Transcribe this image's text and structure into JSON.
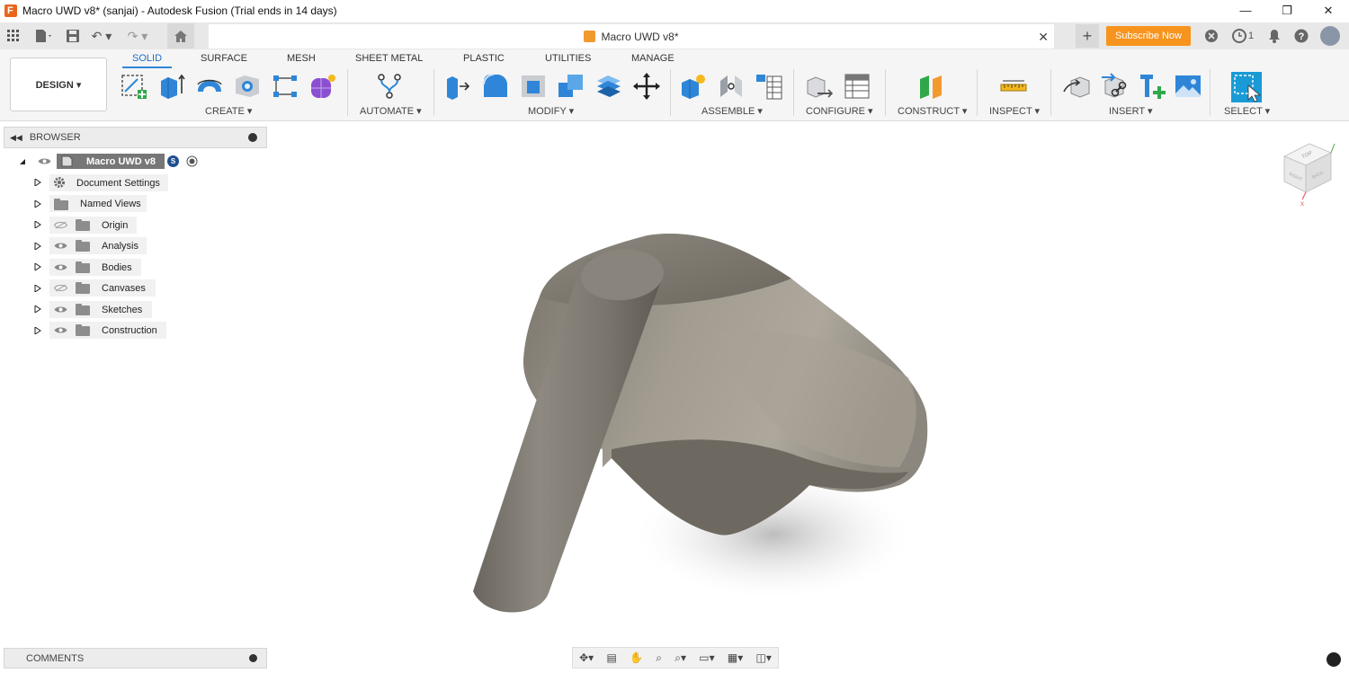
{
  "window": {
    "title": "Macro UWD v8* (sanjai) - Autodesk Fusion (Trial ends in 14 days)"
  },
  "document_tab": {
    "name": "Macro UWD v8*"
  },
  "header_right": {
    "subscribe_label": "Subscribe Now",
    "job_count": "1"
  },
  "workspace": {
    "label": "DESIGN ▾"
  },
  "ribbon_tabs": [
    "SOLID",
    "SURFACE",
    "MESH",
    "SHEET METAL",
    "PLASTIC",
    "UTILITIES",
    "MANAGE"
  ],
  "ribbon_groups": {
    "create": "CREATE ▾",
    "automate": "AUTOMATE ▾",
    "modify": "MODIFY ▾",
    "assemble": "ASSEMBLE ▾",
    "configure": "CONFIGURE ▾",
    "construct": "CONSTRUCT ▾",
    "inspect": "INSPECT ▾",
    "insert": "INSERT ▾",
    "select": "SELECT ▾"
  },
  "browser": {
    "title": "BROWSER",
    "root": "Macro UWD v8",
    "items": [
      "Document Settings",
      "Named Views",
      "Origin",
      "Analysis",
      "Bodies",
      "Canvases",
      "Sketches",
      "Construction"
    ]
  },
  "comments": {
    "title": "COMMENTS"
  },
  "colors": {
    "accent": "#1f6fc5",
    "subscribe": "#f7941d",
    "model_light": "#a7a197",
    "model_dark": "#6f6a62"
  }
}
